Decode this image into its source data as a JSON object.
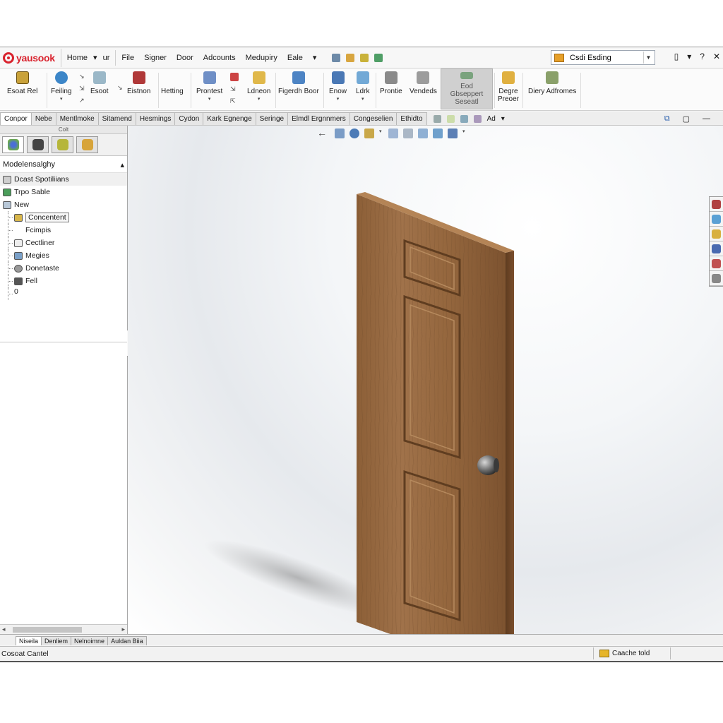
{
  "app": {
    "logo_text": "yausook",
    "home_menu": "Home",
    "home_menu_caret": "▾",
    "home_menu_extra": "ur",
    "menu_items": [
      "File",
      "Signer",
      "Door",
      "Adcounts",
      "Medupiry",
      "Eale"
    ],
    "menu_caret": "▾",
    "search_value": "Csdi Esding",
    "window_controls": [
      "▯",
      "▾",
      "?",
      "✕"
    ]
  },
  "ribbon": {
    "buttons": [
      {
        "label": "Esoat Rel"
      },
      {
        "label": "Feiling",
        "caret": "▾"
      },
      {
        "label": "Esoot"
      },
      {
        "label": "Eistnon"
      },
      {
        "label": "Hetting"
      },
      {
        "label": "Prontest",
        "caret": "▾"
      },
      {
        "label": "Ldneon",
        "caret": "▾"
      },
      {
        "label": "Figerdh Boor"
      },
      {
        "label": "Enow",
        "caret": "▾"
      },
      {
        "label": "Ldrk",
        "caret": "▾"
      },
      {
        "label": "Prontie"
      },
      {
        "label": "Vendeds"
      },
      {
        "label": "Eod Gbseppert Seseatl"
      },
      {
        "label": "Degre Preoer"
      },
      {
        "label": "Diery Adfromes"
      }
    ]
  },
  "tabs": {
    "items": [
      "Conpor",
      "Nebe",
      "Mentlmoke",
      "Sitamend",
      "Hesmings",
      "Cydon",
      "Kark Egnenge",
      "Seringe",
      "Elmdl Ergnnmers",
      "Congeselien",
      "Ethidto"
    ],
    "extra": "Ad",
    "extra_caret": "▾"
  },
  "panel": {
    "header": "Colt",
    "tree_title": "Modelensalghy",
    "collapse_glyph": "▴",
    "tree": [
      {
        "label": "Dcast Spotiliians",
        "level": 1
      },
      {
        "label": "Trpo Sable",
        "level": 1
      },
      {
        "label": "New",
        "level": 1
      },
      {
        "label": "Concentent",
        "level": 2,
        "selected": true
      },
      {
        "label": "Fcimpis",
        "level": 2
      },
      {
        "label": "Cectliner",
        "level": 2
      },
      {
        "label": "Megies",
        "level": 2
      },
      {
        "label": "Donetaste",
        "level": 2
      },
      {
        "label": "Fell",
        "level": 2
      },
      {
        "label": "0",
        "level": 2
      }
    ]
  },
  "bottom_tabs": [
    "Niseila",
    "Denliem",
    "Nelnoimne",
    "Auldan Biia"
  ],
  "status": {
    "left": "Cosoat Cantel",
    "right": "Caache told"
  },
  "colors": {
    "brand_red": "#d9232e",
    "wood_face": "#96693f",
    "wood_dark": "#6b4526",
    "selected_tool_bg": "#d0d0d0"
  }
}
